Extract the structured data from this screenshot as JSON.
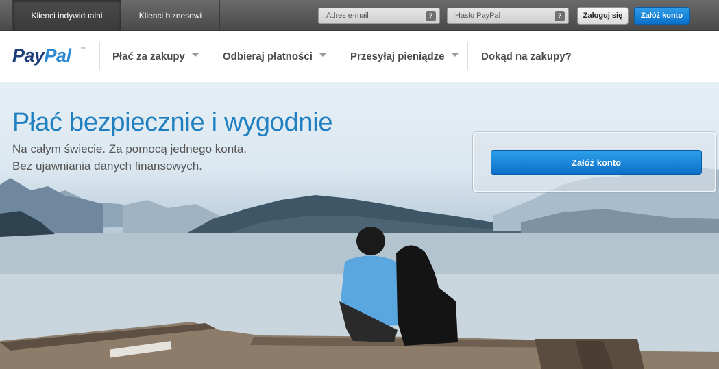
{
  "topbar": {
    "tabs": [
      {
        "label": "Klienci indywidualni",
        "active": true
      },
      {
        "label": "Klienci biznesowi",
        "active": false
      }
    ],
    "email_placeholder": "Adres e-mail",
    "password_placeholder": "Hasło PayPal",
    "help_label": "?",
    "login_label": "Zaloguj się",
    "signup_label": "Załóż konto"
  },
  "navbar": {
    "logo_pay": "Pay",
    "logo_pal": "Pal",
    "logo_tm": "tm",
    "items": [
      {
        "label": "Płać za zakupy",
        "dropdown": true
      },
      {
        "label": "Odbieraj płatności",
        "dropdown": true
      },
      {
        "label": "Przesyłaj pieniądze",
        "dropdown": true
      },
      {
        "label": "Dokąd na zakupy?",
        "dropdown": false
      }
    ]
  },
  "hero": {
    "title": "Płać bezpiecznie i wygodnie",
    "subtitle_line1": "Na całym świecie. Za pomocą jednego konta.",
    "subtitle_line2": "Bez ujawniania danych finansowych.",
    "cta_label": "Załóż konto",
    "image_description": "couple-sitting-on-pier-by-lake-icon"
  },
  "colors": {
    "brand_blue": "#1f7fc0",
    "button_blue": "#0b6fc9",
    "topbar_gray": "#4a4a4a"
  }
}
